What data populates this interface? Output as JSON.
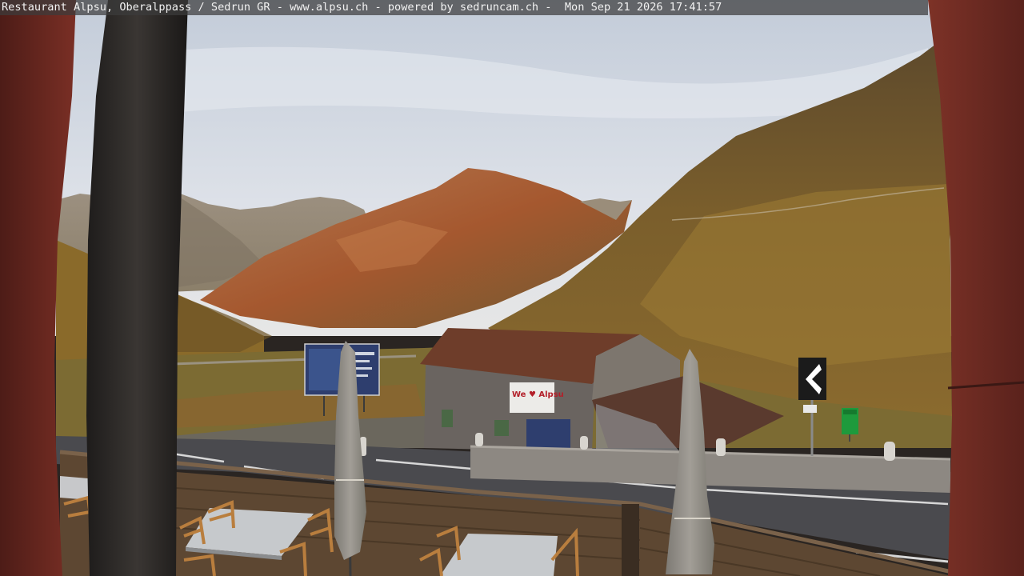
{
  "overlay": {
    "caption": "Restaurant Alpsu, Oberalppass / Sedrun GR - www.alpsu.ch - powered by sedruncam.ch -  Mon Sep 21 2026 17:41:57"
  },
  "scene": {
    "building_sign": "We ♥ Alpsu",
    "colors": {
      "sky_top": "#c9d1dd",
      "sky_bottom": "#dfe3ea",
      "mountain_autumn": "#b0653b",
      "grass_slope": "#7a6a2e",
      "road": "#4a4a4e",
      "frame_wood": "#6b2a22",
      "umbrella": "#8d8a84",
      "billboard": "#2e3e6e",
      "bin_green": "#1e9a3c"
    },
    "icons": [
      "chevron-left-sign",
      "green-trash-bin",
      "closed-umbrella"
    ]
  }
}
